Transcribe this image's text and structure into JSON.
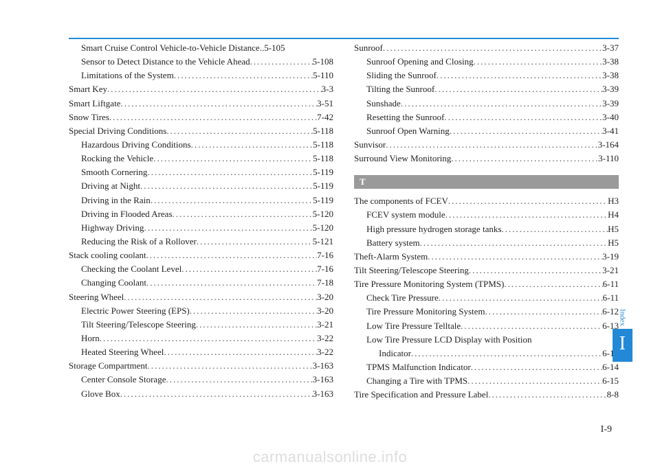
{
  "page_number": "I-9",
  "tab_label": "Index",
  "tab_letter": "I",
  "watermark": "carmanualsonline.info",
  "section_letter_T": "T",
  "left_column": [
    {
      "label": "Smart Cruise Control Vehicle-to-Vehicle Distance",
      "page": "5-105",
      "indent": 1,
      "dots": false
    },
    {
      "label": "Sensor to Detect Distance to the Vehicle Ahead",
      "page": "5-108",
      "indent": 1
    },
    {
      "label": "Limitations of the System",
      "page": "5-110",
      "indent": 1
    },
    {
      "label": "Smart Key",
      "page": "3-3",
      "indent": 0
    },
    {
      "label": "Smart Liftgate",
      "page": "3-51",
      "indent": 0
    },
    {
      "label": "Snow Tires",
      "page": "7-42",
      "indent": 0
    },
    {
      "label": "Special Driving Conditions",
      "page": "5-118",
      "indent": 0
    },
    {
      "label": "Hazardous Driving Conditions",
      "page": "5-118",
      "indent": 1
    },
    {
      "label": "Rocking the Vehicle",
      "page": "5-118",
      "indent": 1
    },
    {
      "label": "Smooth Cornering",
      "page": "5-119",
      "indent": 1
    },
    {
      "label": "Driving at Night",
      "page": "5-119",
      "indent": 1
    },
    {
      "label": "Driving in the Rain",
      "page": "5-119",
      "indent": 1
    },
    {
      "label": "Driving in Flooded Areas",
      "page": "5-120",
      "indent": 1
    },
    {
      "label": "Highway Driving",
      "page": "5-120",
      "indent": 1
    },
    {
      "label": "Reducing the Risk of a Rollover",
      "page": "5-121",
      "indent": 1
    },
    {
      "label": "Stack cooling coolant",
      "page": "7-16",
      "indent": 0
    },
    {
      "label": "Checking the Coolant Level",
      "page": "7-16",
      "indent": 1
    },
    {
      "label": "Changing Coolant",
      "page": "7-18",
      "indent": 1
    },
    {
      "label": "Steering Wheel",
      "page": "3-20",
      "indent": 0
    },
    {
      "label": "Electric Power Steering (EPS)",
      "page": "3-20",
      "indent": 1
    },
    {
      "label": "Tilt Steering/Telescope Steering",
      "page": "3-21",
      "indent": 1
    },
    {
      "label": "Horn",
      "page": "3-22",
      "indent": 1
    },
    {
      "label": "Heated Steering Wheel",
      "page": "3-22",
      "indent": 1
    },
    {
      "label": "Storage Compartment",
      "page": "3-163",
      "indent": 0
    },
    {
      "label": "Center Console Storage",
      "page": "3-163",
      "indent": 1
    },
    {
      "label": "Glove Box",
      "page": "3-163",
      "indent": 1
    }
  ],
  "right_column_top": [
    {
      "label": "Sunroof",
      "page": "3-37",
      "indent": 0
    },
    {
      "label": "Sunroof Opening and Closing",
      "page": "3-38",
      "indent": 1
    },
    {
      "label": "Sliding the Sunroof",
      "page": "3-38",
      "indent": 1
    },
    {
      "label": "Tilting the Sunroof",
      "page": "3-39",
      "indent": 1
    },
    {
      "label": "Sunshade",
      "page": "3-39",
      "indent": 1
    },
    {
      "label": "Resetting the Sunroof",
      "page": "3-40",
      "indent": 1
    },
    {
      "label": "Sunroof Open Warning",
      "page": "3-41",
      "indent": 1
    },
    {
      "label": "Sunvisor",
      "page": "3-164",
      "indent": 0
    },
    {
      "label": "Surround View Monitoring",
      "page": "3-110",
      "indent": 0
    }
  ],
  "right_column_T": [
    {
      "label": "The components of FCEV",
      "page": "H3",
      "indent": 0
    },
    {
      "label": "FCEV system module",
      "page": "H4",
      "indent": 1
    },
    {
      "label": "High pressure hydrogen storage tanks",
      "page": "H5",
      "indent": 1
    },
    {
      "label": "Battery system",
      "page": "H5",
      "indent": 1
    },
    {
      "label": "Theft-Alarm System",
      "page": "3-19",
      "indent": 0
    },
    {
      "label": "Tilt Steering/Telescope Steering",
      "page": "3-21",
      "indent": 0
    },
    {
      "label": "Tire Pressure Monitoring System (TPMS)",
      "page": "6-11",
      "indent": 0
    },
    {
      "label": "Check Tire Pressure",
      "page": "6-11",
      "indent": 1
    },
    {
      "label": "Tire Pressure Monitoring System",
      "page": "6-12",
      "indent": 1
    },
    {
      "label": "Low Tire Pressure Telltale",
      "page": "6-13",
      "indent": 1
    },
    {
      "label": "Low Tire Pressure LCD Display with Position",
      "page": "",
      "indent": 1,
      "nodots": true
    },
    {
      "label": "Indicator",
      "page": "6-13",
      "indent": 2
    },
    {
      "label": "TPMS Malfunction Indicator",
      "page": "6-14",
      "indent": 1
    },
    {
      "label": "Changing a Tire with TPMS",
      "page": "6-15",
      "indent": 1
    },
    {
      "label": "Tire Specification and Pressure Label",
      "page": "8-8",
      "indent": 0
    }
  ]
}
